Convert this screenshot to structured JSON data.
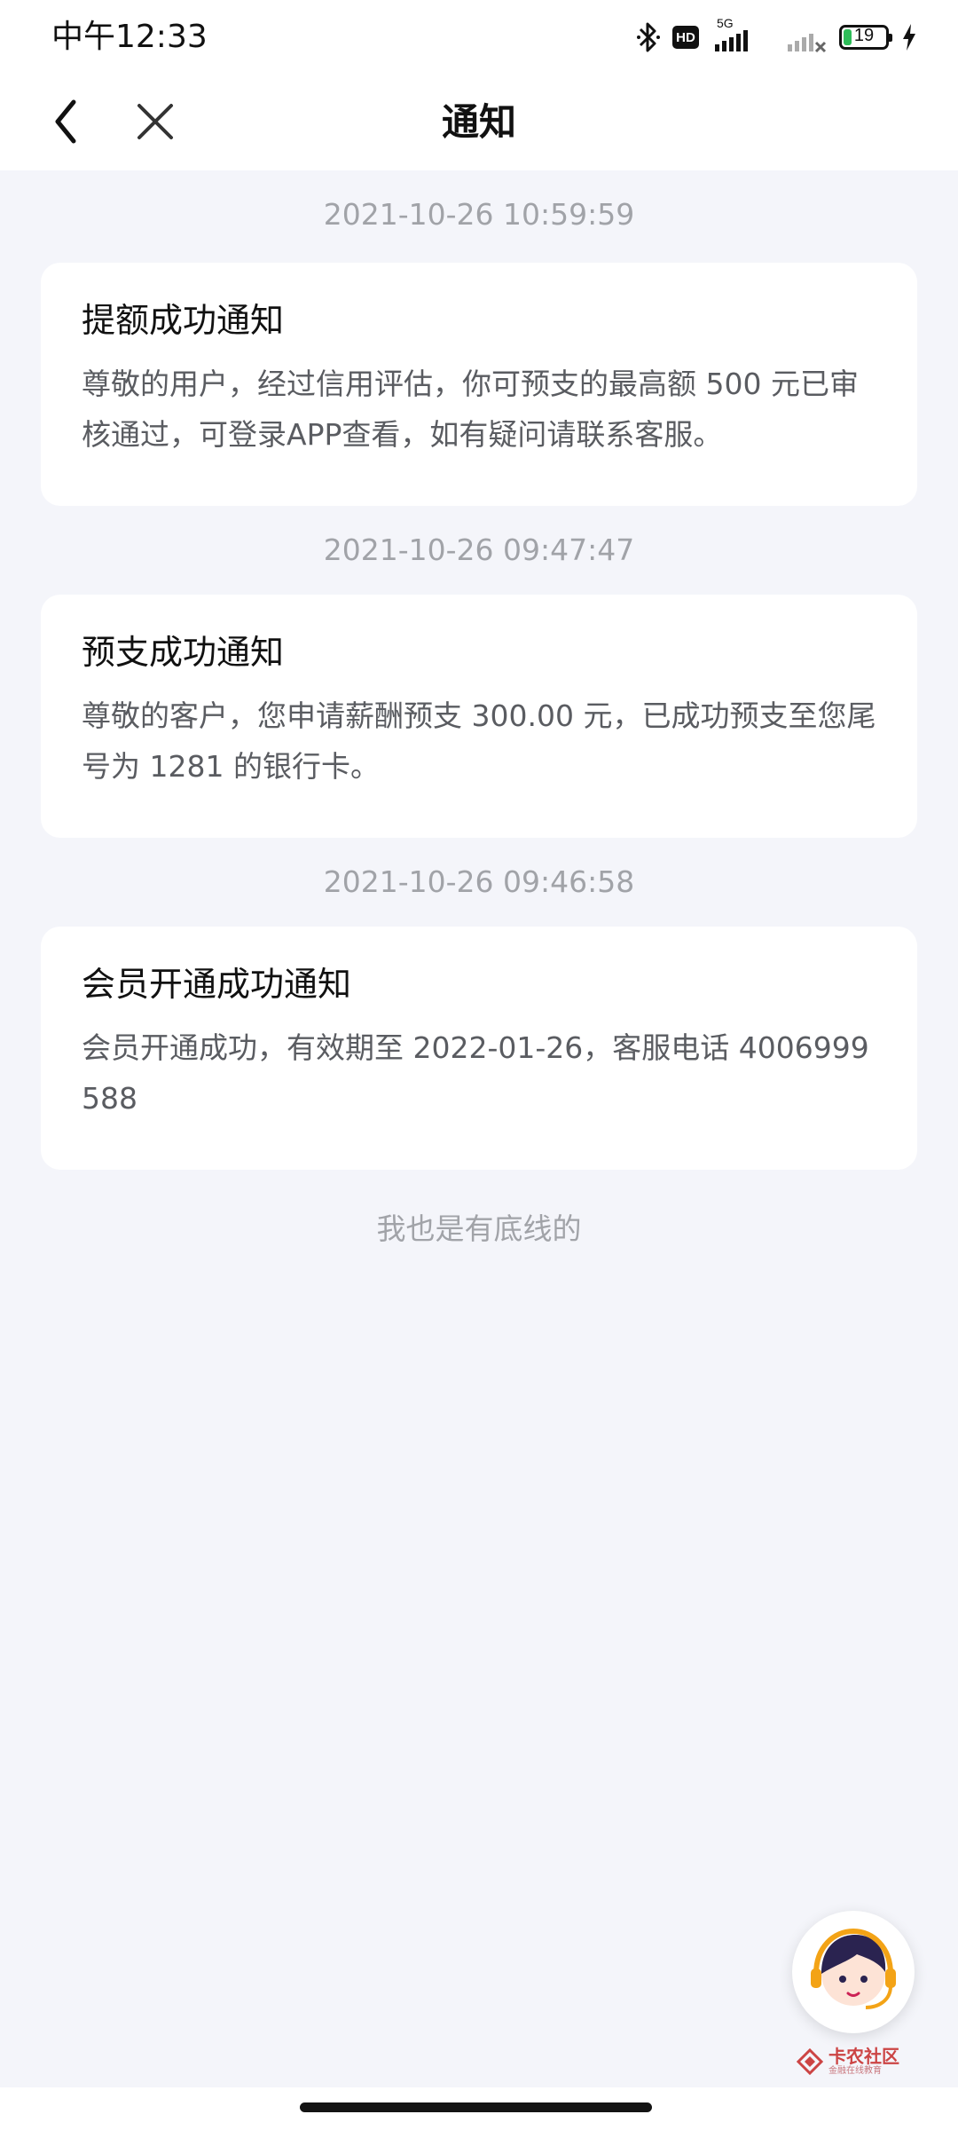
{
  "status_bar": {
    "time": "中午12:33",
    "network": "5G",
    "hd": "HD",
    "battery_level": "19",
    "battery_fraction": 0.19
  },
  "header": {
    "title": "通知",
    "back_icon": "chevron-left-icon",
    "close_icon": "close-icon"
  },
  "notifications": [
    {
      "timestamp": "2021-10-26 10:59:59",
      "title": "提额成功通知",
      "body": "尊敬的用户，经过信用评估，你可预支的最高额 500 元已审核通过，可登录APP查看，如有疑问请联系客服。"
    },
    {
      "timestamp": "2021-10-26 09:47:47",
      "title": "预支成功通知",
      "body": "尊敬的客户，您申请薪酬预支 300.00 元，已成功预支至您尾号为 1281 的银行卡。"
    },
    {
      "timestamp": "2021-10-26 09:46:58",
      "title": "会员开通成功通知",
      "body": "会员开通成功，有效期至 2022-01-26，客服电话 4006999588"
    }
  ],
  "footer_note": "我也是有底线的",
  "watermark": {
    "text": "卡农社区",
    "sub": "金融在线教育"
  },
  "colors": {
    "background": "#f4f5fa",
    "card": "#ffffff",
    "timestamp": "#a1a3a8",
    "battery": "#2ebd59"
  }
}
